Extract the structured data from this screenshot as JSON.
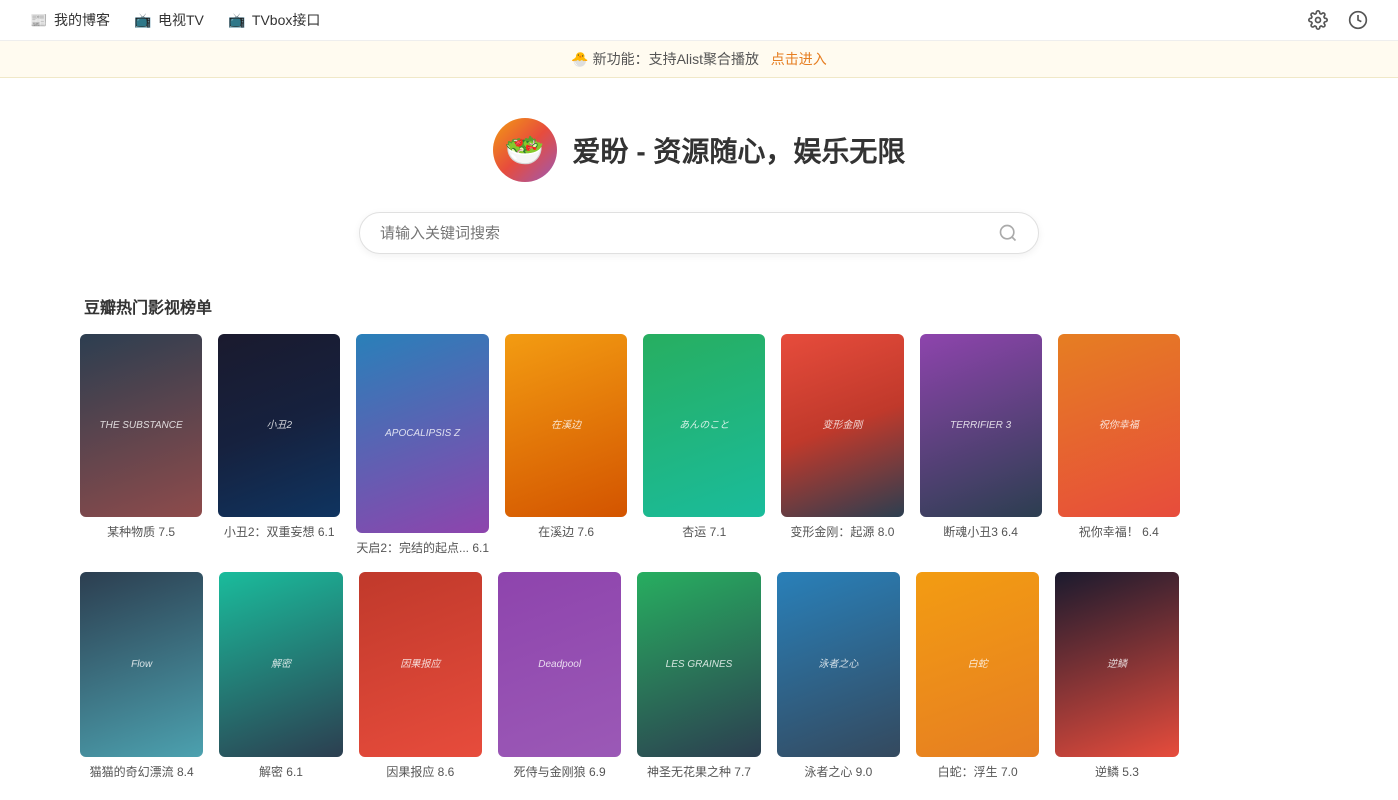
{
  "nav": {
    "items": [
      {
        "label": "我的博客",
        "icon": "📰"
      },
      {
        "label": "电视TV",
        "icon": "📺"
      },
      {
        "label": "TVbox接口",
        "icon": "📺"
      }
    ],
    "settings_icon": "⚙",
    "user_icon": "⏱"
  },
  "banner": {
    "emoji": "🐣",
    "text": "新功能：支持Alist聚合播放",
    "link_text": "点击进入"
  },
  "hero": {
    "logo_emoji": "🥗",
    "title": "爱盼 - 资源随心，娱乐无限",
    "search_placeholder": "请输入关键词搜索"
  },
  "section": {
    "title": "豆瓣热门影视榜单",
    "row1": [
      {
        "title": "某种物质",
        "rating": "7.5",
        "color": "p1",
        "en_text": "THE SUBSTANCE"
      },
      {
        "title": "小丑2：双重妄想",
        "rating": "6.1",
        "color": "p2",
        "en_text": "小丑2"
      },
      {
        "title": "天启2：完结的起点...",
        "rating": "6.1",
        "color": "p3",
        "en_text": "APOCALIPSIS Z"
      },
      {
        "title": "在溪边",
        "rating": "7.6",
        "color": "p4",
        "en_text": "在溪边"
      },
      {
        "title": "杏运",
        "rating": "7.1",
        "color": "p5",
        "en_text": "あんのこと"
      },
      {
        "title": "变形金刚：起源",
        "rating": "8.0",
        "color": "p6",
        "en_text": "变形金刚"
      },
      {
        "title": "断魂小丑3",
        "rating": "6.4",
        "color": "p7",
        "en_text": "TERRIFIER 3"
      },
      {
        "title": "祝你幸福！",
        "rating": "6.4",
        "color": "p8",
        "en_text": "祝你幸福"
      }
    ],
    "row2": [
      {
        "title": "猫猫的奇幻漂流",
        "rating": "8.4",
        "color": "p10",
        "en_text": "Flow"
      },
      {
        "title": "解密",
        "rating": "6.1",
        "color": "p11",
        "en_text": "解密"
      },
      {
        "title": "因果报应",
        "rating": "8.6",
        "color": "p12",
        "en_text": "因果报应"
      },
      {
        "title": "死侍与金刚狼",
        "rating": "6.9",
        "color": "p13",
        "en_text": "Deadpool"
      },
      {
        "title": "神圣无花果之种",
        "rating": "7.7",
        "color": "p14",
        "en_text": "LES GRAINES"
      },
      {
        "title": "泳者之心",
        "rating": "9.0",
        "color": "p15",
        "en_text": "泳者之心"
      },
      {
        "title": "白蛇：浮生",
        "rating": "7.0",
        "color": "p16",
        "en_text": "白蛇"
      },
      {
        "title": "逆鳞",
        "rating": "5.3",
        "color": "p17",
        "en_text": "逆鳞"
      }
    ]
  }
}
